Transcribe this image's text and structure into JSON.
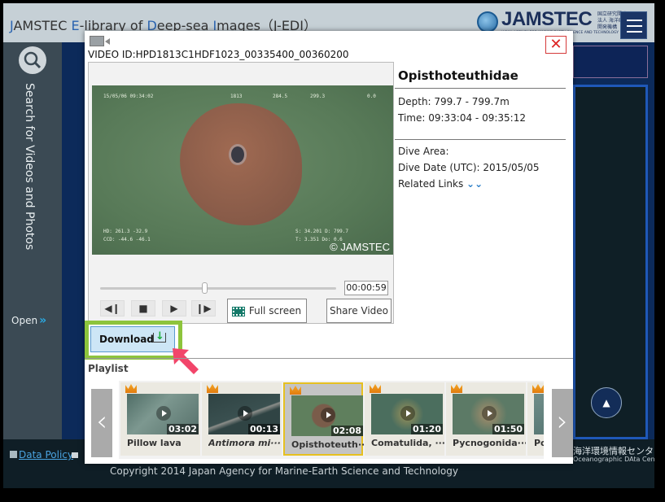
{
  "header": {
    "title_parts": [
      "J",
      "AMSTEC ",
      "E",
      "-library of ",
      "D",
      "eep-sea ",
      "I",
      "mages（J-EDI）"
    ],
    "logo_text": "JAMSTEC",
    "logo_jp": "国立研究開発法人 海洋研究開発機構",
    "logo_en": "JAPAN AGENCY FOR MARINE-EARTH SCIENCE AND TECHNOLOGY",
    "menu_icon": "hamburger-icon"
  },
  "sidebar": {
    "search_icon": "search-icon",
    "label": "Search for Videos and Photos",
    "open_label": "Open",
    "open_icon": "double-chevron-right-icon"
  },
  "modal": {
    "video_id": "VIDEO ID:HPD1813C1HDF1023_00335400_00360200",
    "close_label": "✕",
    "player": {
      "osd_top_left": "15/05/06 09:34:02",
      "osd_top_mid": "1813",
      "osd_top_v1": "284.5",
      "osd_top_v2": "299.3",
      "osd_top_v3": "0.0",
      "osd_bottom_left": "HD:   261.3   -32.9",
      "osd_bottom_left2": "CCD:  -44.6   -46.1",
      "osd_bottom_right": "S: 34.201   D: 799.7",
      "osd_bottom_right2": "T:  3.351   Do: 0.6",
      "watermark": "© JAMSTEC",
      "current_time": "00:00:59",
      "progress": 0.44,
      "controls": [
        "step-back",
        "stop",
        "play",
        "step-forward"
      ],
      "fullscreen_label": "Full screen",
      "share_label": "Share Video"
    },
    "download_label": "Download",
    "info": {
      "title": "Opisthoteuthidae",
      "depth": "Depth: 799.7 - 799.7m",
      "time": "Time: 09:33:04 - 09:35:12",
      "dive_area": "Dive Area:",
      "dive_date": "Dive Date (UTC): 2015/05/05",
      "related_links": "Related Links",
      "related_icon": "double-chevron-down-icon"
    },
    "playlist": {
      "label": "Playlist",
      "items": [
        {
          "title": "Pillow lava",
          "duration": "03:02",
          "italic": false,
          "active": false
        },
        {
          "title": "Antimora mi···",
          "duration": "00:13",
          "italic": true,
          "active": false
        },
        {
          "title": "Opisthoteuth···",
          "duration": "02:08",
          "italic": false,
          "active": true
        },
        {
          "title": "Comatulida, ···",
          "duration": "01:20",
          "italic": false,
          "active": false
        },
        {
          "title": "Pycnogonida···",
          "duration": "01:50",
          "italic": false,
          "active": false
        },
        {
          "title": "Po",
          "duration": "",
          "italic": false,
          "active": false
        }
      ]
    }
  },
  "footer": {
    "data_policy": "Data Policy",
    "copyright": "Copyright 2014 Japan Agency for Marine-Earth Science and Technology",
    "jodc_jp": "海洋環境情報センター",
    "jodc_en": "Oceanographic DAta Center"
  },
  "colors": {
    "accent_blue": "#2b64b0",
    "highlight_green": "#8dc43c",
    "active_border": "#e6c020",
    "close_red": "#d22222",
    "arrow_pink": "#f2456a"
  }
}
